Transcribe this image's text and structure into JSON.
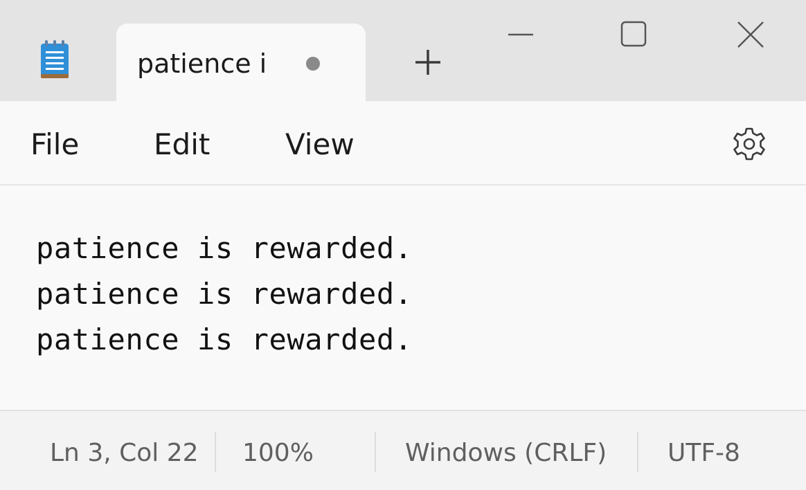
{
  "tab": {
    "title": "patience i",
    "unsaved_indicator": "dot",
    "icon": "notepad-icon"
  },
  "window_controls": {
    "new_tab_icon": "plus-icon",
    "minimize_icon": "minimize-icon",
    "maximize_icon": "maximize-icon",
    "close_icon": "close-icon"
  },
  "menu": {
    "file": "File",
    "edit": "Edit",
    "view": "View",
    "settings_icon": "gear-icon"
  },
  "editor": {
    "lines": [
      "patience is rewarded.",
      "patience is rewarded.",
      "patience is rewarded."
    ]
  },
  "status": {
    "position": "Ln 3, Col 22",
    "zoom": "100%",
    "line_ending": "Windows (CRLF)",
    "encoding": "UTF-8"
  },
  "colors": {
    "titlebar": "#e4e4e4",
    "background": "#f9f9f9",
    "statusbar": "#f3f3f3",
    "text": "#1b1b1b",
    "status_text": "#5f5f5f",
    "icon_blue": "#2f8fd8"
  }
}
